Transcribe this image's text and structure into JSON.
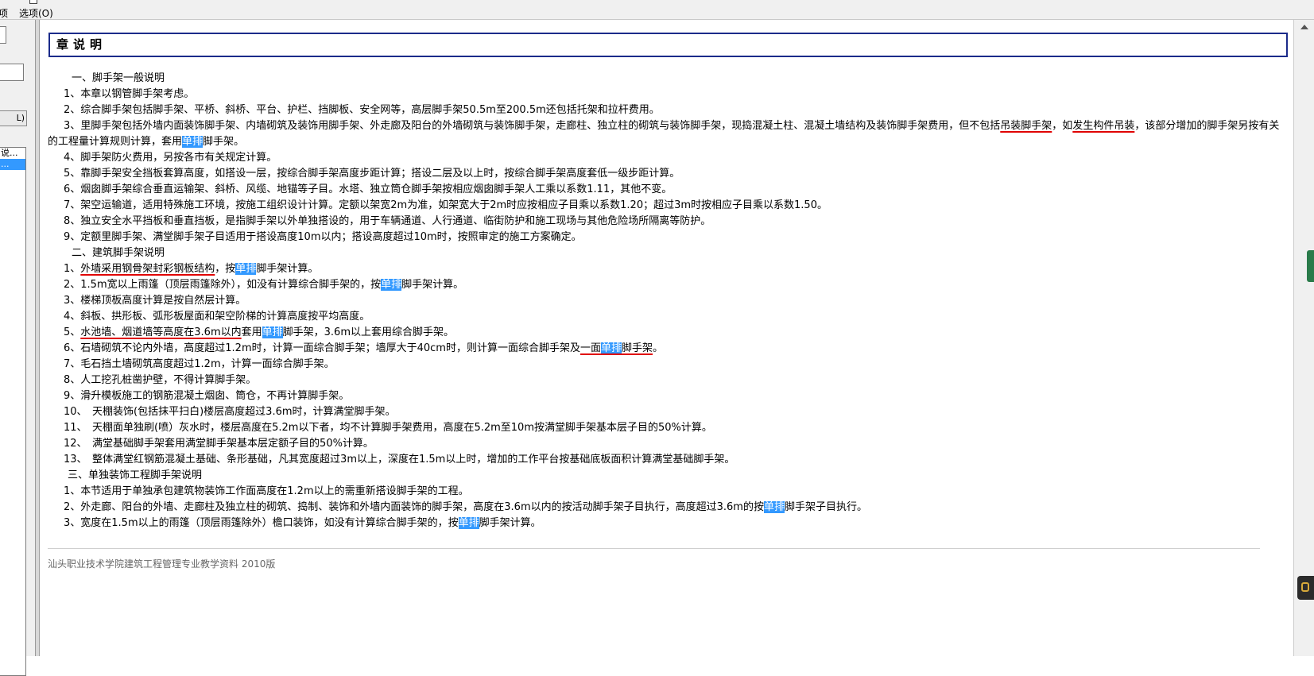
{
  "toolbar": {
    "left_label": "项",
    "options_label": "选项(O)"
  },
  "left_pane": {
    "button_label": "L)",
    "list_items": [
      {
        "label": "说..."
      },
      {
        "label": "..."
      }
    ]
  },
  "document": {
    "heading": "章说明",
    "sections": [
      {
        "title": "一、脚手架一般说明",
        "items": [
          {
            "segments": [
              {
                "t": "1、本章以钢管脚手架考虑。"
              }
            ]
          },
          {
            "segments": [
              {
                "t": "2、综合脚手架包括脚手架、平桥、斜桥、平台、护栏、挡脚板、安全网等，高层脚手架50.5m至200.5m还包括托架和拉杆费用。"
              }
            ]
          },
          {
            "wrap": true,
            "segments": [
              {
                "t": "3、里脚手架包括外墙内面装饰脚手架、内墙砌筑及装饰用脚手架、外走廊及阳台的外墙砌筑与装饰脚手架，走廊柱、独立柱的砌筑与装饰脚手架，现捣混凝土柱、混凝土墙结构及装饰脚手架费用，但不包括"
              },
              {
                "t": "吊装脚手架",
                "u": true
              },
              {
                "t": "，如"
              },
              {
                "t": "发生构件吊装",
                "u": true
              },
              {
                "t": "，该部分增加的脚手架另按有关的工程量计算规则计算，套用"
              },
              {
                "t": "单排",
                "h": true
              },
              {
                "t": "脚手架。"
              }
            ]
          },
          {
            "segments": [
              {
                "t": "4、脚手架防火费用，另按各市有关规定计算。"
              }
            ]
          },
          {
            "segments": [
              {
                "t": "5、靠脚手架安全挡板套算高度，如搭设一层，按综合脚手架高度步距计算；搭设二层及以上时，按综合脚手架高度套低一级步距计算。"
              }
            ]
          },
          {
            "segments": [
              {
                "t": "6、烟囱脚手架综合垂直运输架、斜桥、风缆、地锚等子目。水塔、独立筒仓脚手架按相应烟囱脚手架人工乘以系数1.11，其他不变。"
              }
            ]
          },
          {
            "segments": [
              {
                "t": "7、架空运输道，适用特殊施工环境，按施工组织设计计算。定额以架宽2m为准，如架宽大于2m时应按相应子目乘以系数1.20；超过3m时按相应子目乘以系数1.50。"
              }
            ]
          },
          {
            "segments": [
              {
                "t": "8、独立安全水平挡板和垂直挡板，是指脚手架以外单独搭设的，用于车辆通道、人行通道、临街防护和施工现场与其他危险场所隔离等防护。"
              }
            ]
          },
          {
            "segments": [
              {
                "t": "9、定额里脚手架、满堂脚手架子目适用于搭设高度10m以内；搭设高度超过10m时，按照审定的施工方案确定。"
              }
            ]
          }
        ]
      },
      {
        "title": "二、建筑脚手架说明",
        "items": [
          {
            "segments": [
              {
                "t": "1、"
              },
              {
                "t": "外墙采用钢骨架封彩钢板结构",
                "u": true
              },
              {
                "t": "，按"
              },
              {
                "t": "单排",
                "h": true
              },
              {
                "t": "脚手架计算。"
              }
            ]
          },
          {
            "segments": [
              {
                "t": "2、1.5m宽以上雨篷（顶层雨篷除外），如没有计算综合脚手架的，按"
              },
              {
                "t": "单排",
                "h": true
              },
              {
                "t": "脚手架计算。"
              }
            ]
          },
          {
            "segments": [
              {
                "t": "3、楼梯顶板高度计算是按自然层计算。"
              }
            ]
          },
          {
            "segments": [
              {
                "t": "4、斜板、拱形板、弧形板屋面和架空阶梯的计算高度按平均高度。"
              }
            ]
          },
          {
            "segments": [
              {
                "t": "5、"
              },
              {
                "t": "水池墙、烟道墙等高度在3.6m以内",
                "u": true
              },
              {
                "t": "套用"
              },
              {
                "t": "单排",
                "h": true
              },
              {
                "t": "脚手架，3.6m以上套用综合脚手架。"
              }
            ]
          },
          {
            "segments": [
              {
                "t": "6、石墙砌筑不论内外墙，高度超过1.2m时，计算一面综合脚手架；墙厚大于40cm时，则计算一面综合脚手架及"
              },
              {
                "t": "一面",
                "u": true
              },
              {
                "t": "单排",
                "h": true,
                "u": true
              },
              {
                "t": "脚手架",
                "u": true
              },
              {
                "t": "。"
              }
            ]
          },
          {
            "segments": [
              {
                "t": "7、毛石挡土墙砌筑高度超过1.2m，计算一面综合脚手架。"
              }
            ]
          },
          {
            "segments": [
              {
                "t": "8、人工挖孔桩凿护壁，不得计算脚手架。"
              }
            ]
          },
          {
            "segments": [
              {
                "t": "9、滑升模板施工的钢筋混凝土烟囱、筒仓，不再计算脚手架。"
              }
            ]
          },
          {
            "segments": [
              {
                "t": "10、　天棚装饰(包括抹平扫白)楼层高度超过3.6m时，计算满堂脚手架。"
              }
            ]
          },
          {
            "segments": [
              {
                "t": "11、　天棚面单独刷(喷）灰水时，楼层高度在5.2m以下者，均不计算脚手架费用，高度在5.2m至10m按满堂脚手架基本层子目的50%计算。"
              }
            ]
          },
          {
            "segments": [
              {
                "t": "12、　满堂基础脚手架套用满堂脚手架基本层定额子目的50%计算。"
              }
            ]
          },
          {
            "segments": [
              {
                "t": "13、　整体满堂红钢筋混凝土基础、条形基础，凡其宽度超过3m以上，深度在1.5m以上时，增加的工作平台按基础底板面积计算满堂基础脚手架。"
              }
            ]
          }
        ]
      },
      {
        "title": "三、单独装饰工程脚手架说明",
        "items": [
          {
            "segments": [
              {
                "t": "1、本节适用于单独承包建筑物装饰工作面高度在1.2m以上的需重新搭设脚手架的工程。"
              }
            ]
          },
          {
            "segments": [
              {
                "t": "2、外走廊、阳台的外墙、走廊柱及独立柱的砌筑、捣制、装饰和外墙内面装饰的脚手架，高度在3.6m以内的按活动脚手架子目执行，高度超过3.6m的按"
              },
              {
                "t": "单排",
                "h": true
              },
              {
                "t": "脚手架子目执行。"
              }
            ]
          },
          {
            "segments": [
              {
                "t": "3、宽度在1.5m以上的雨篷（顶层雨篷除外）檐口装饰，如没有计算综合脚手架的，按"
              },
              {
                "t": "单排",
                "h": true
              },
              {
                "t": "脚手架计算。"
              }
            ]
          }
        ]
      }
    ],
    "footer": "汕头职业技术学院建筑工程管理专业教学资料 2010版"
  },
  "colors": {
    "highlight": "#3399ff",
    "underline": "#e00000",
    "title_border": "#1b2b8a"
  }
}
